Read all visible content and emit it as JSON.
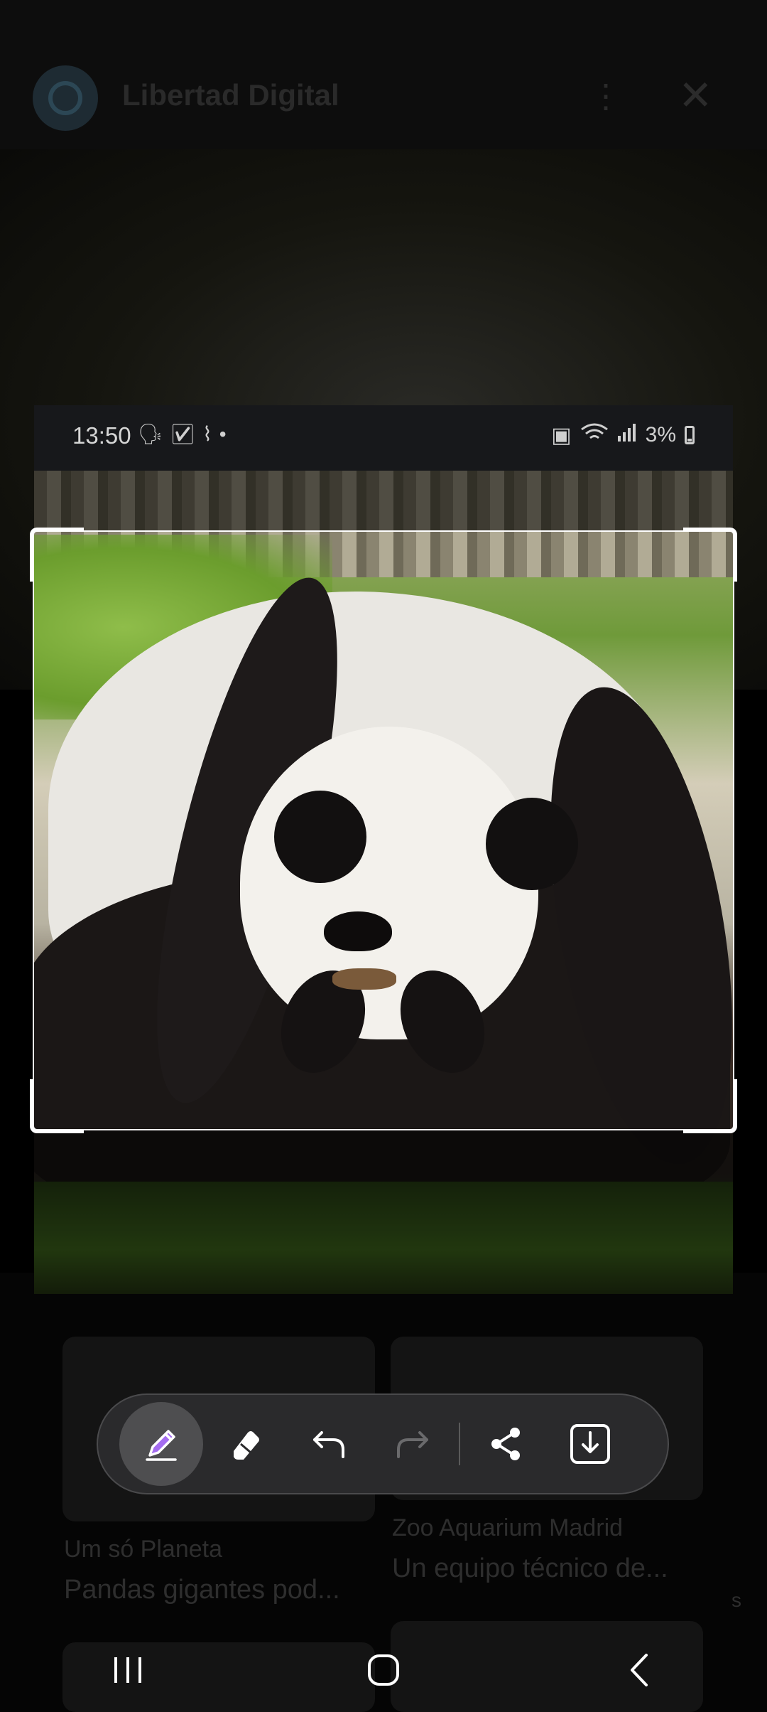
{
  "background_app": {
    "title": "Libertad Digital",
    "cards": [
      {
        "source": "Um só Planeta",
        "headline": "Pandas gigantes pod..."
      },
      {
        "source": "Zoo Aquarium Madrid",
        "headline": "Un equipo técnico de..."
      }
    ],
    "side_letter": "s"
  },
  "status_bar": {
    "time": "13:50",
    "battery": "3%"
  },
  "screenshot_toolbar": {
    "tools": [
      {
        "name": "pen",
        "active": true
      },
      {
        "name": "eraser",
        "active": false
      },
      {
        "name": "undo",
        "active": false
      },
      {
        "name": "redo",
        "active": false,
        "enabled": false
      },
      {
        "name": "share",
        "active": false
      },
      {
        "name": "save",
        "active": false
      }
    ],
    "accent_color": "#a46cf0"
  },
  "nav_bar": {
    "buttons": [
      "recent-apps",
      "home",
      "back"
    ]
  }
}
